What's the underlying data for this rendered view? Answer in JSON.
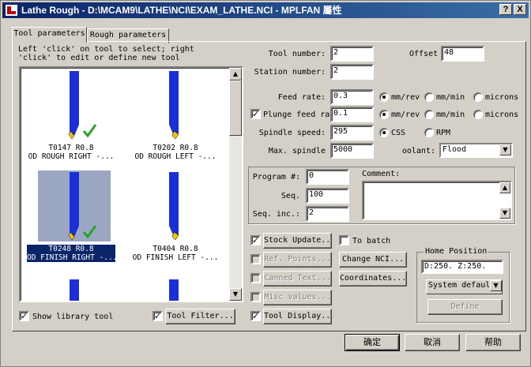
{
  "window": {
    "title": "Lathe Rough - D:\\MCAM9\\LATHE\\NCI\\EXAM_LATHE.NCI - MPLFAN 屬性",
    "help_btn": "?",
    "close_btn": "X"
  },
  "tabs": [
    "Tool parameters",
    "Rough parameters"
  ],
  "tool_list": {
    "hint_1": "Left 'click' on tool to select; right",
    "hint_2": "'click' to edit or define new tool",
    "items": [
      {
        "code": "T0147 R0.8",
        "desc": "OD ROUGH RIGHT -...",
        "checked": true,
        "selected": false
      },
      {
        "code": "T0202 R0.8",
        "desc": "OD ROUGH LEFT -...",
        "checked": false,
        "selected": false
      },
      {
        "code": "T0248 R0.8",
        "desc": "OD FINISH RIGHT -...",
        "checked": true,
        "selected": true
      },
      {
        "code": "T0404 R0.8",
        "desc": "OD FINISH LEFT -...",
        "checked": false,
        "selected": false
      }
    ],
    "show_library_label": "Show library tool",
    "tool_filter_label": "Tool Filter..."
  },
  "tool_info": {
    "tool_number_label": "Tool number:",
    "tool_number": "2",
    "offset_label": "Offset",
    "offset": "48",
    "station_number_label": "Station number:",
    "station_number": "2"
  },
  "feeds": {
    "feed_rate_label": "Feed rate:",
    "feed_rate": "0.3",
    "plunge_label": "Plunge feed ra",
    "plunge_rate": "0.1",
    "spindle_label": "Spindle speed:",
    "spindle_speed": "295",
    "max_spindle_label": "Max. spindle",
    "max_spindle": "5000",
    "unit_mmrev": "mm/rev",
    "unit_mmmin": "mm/min",
    "unit_microns": "microns",
    "css_label": "CSS",
    "rpm_label": "RPM",
    "coolant_label": "oolant:",
    "coolant_value": "Flood"
  },
  "program": {
    "program_label": "Program #:",
    "program_num": "0",
    "seq_label": "Seq.",
    "seq": "100",
    "seq_inc_label": "Seq. inc.:",
    "seq_inc": "2",
    "comment_label": "Comment:"
  },
  "options": {
    "stock_update": "Stock Update...",
    "to_batch": "To batch",
    "ref_points": "Ref. Points...",
    "change_nci": "Change NCI...",
    "canned_text": "Canned Text...",
    "coordinates": "Coordinates...",
    "misc_values": "Misc values...",
    "tool_display": "Tool Display..."
  },
  "home_position": {
    "title": "Home Position",
    "coords": "D:250.  Z:250.",
    "system_default": "System defaul",
    "define": "Define"
  },
  "footer": {
    "ok": "确定",
    "cancel": "取消",
    "help": "帮助"
  },
  "colors": {
    "title_start": "#0a246a",
    "title_end": "#3a6ea5",
    "face": "#d4d0c8",
    "tool_blue": "#1a2fd6",
    "insert_yellow": "#f5c400",
    "check_green": "#2aa52a",
    "selected_bg": "#0a246a"
  }
}
